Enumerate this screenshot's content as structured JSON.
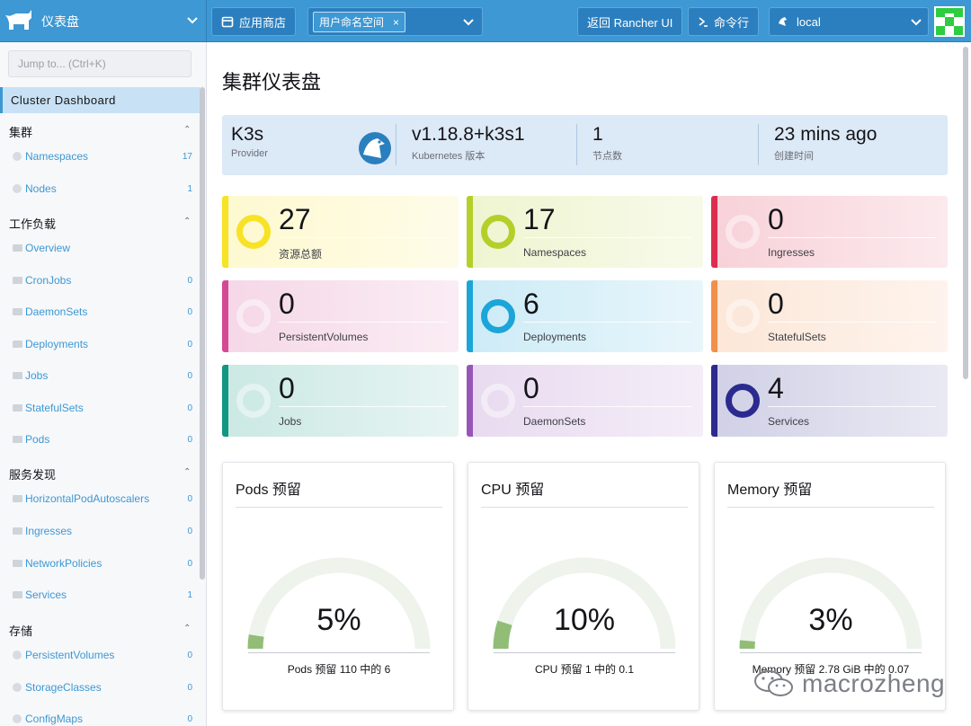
{
  "header": {
    "title": "仪表盘",
    "app_store": "应用商店",
    "namespace_tag": "用户命名空间",
    "namespace_remove": "×",
    "back_rancher": "返回 Rancher UI",
    "kubectl": "命令行",
    "cluster": "local"
  },
  "sidebar": {
    "jump_placeholder": "Jump to... (Ctrl+K)",
    "active": "Cluster Dashboard",
    "groups": [
      {
        "label": "集群"
      },
      {
        "label": "工作负载"
      },
      {
        "label": "服务发现"
      },
      {
        "label": "存储"
      }
    ],
    "items": [
      {
        "label": "Namespaces",
        "count": "17"
      },
      {
        "label": "Nodes",
        "count": "1"
      },
      {
        "label": "Overview",
        "count": ""
      },
      {
        "label": "CronJobs",
        "count": "0"
      },
      {
        "label": "DaemonSets",
        "count": "0"
      },
      {
        "label": "Deployments",
        "count": "0"
      },
      {
        "label": "Jobs",
        "count": "0"
      },
      {
        "label": "StatefulSets",
        "count": "0"
      },
      {
        "label": "Pods",
        "count": "0"
      },
      {
        "label": "HorizontalPodAutoscalers",
        "count": "0"
      },
      {
        "label": "Ingresses",
        "count": "0"
      },
      {
        "label": "NetworkPolicies",
        "count": "0"
      },
      {
        "label": "Services",
        "count": "1"
      },
      {
        "label": "PersistentVolumes",
        "count": "0"
      },
      {
        "label": "StorageClasses",
        "count": "0"
      },
      {
        "label": "ConfigMaps",
        "count": "0"
      }
    ]
  },
  "main": {
    "title": "集群仪表盘",
    "info": {
      "provider_value": "K3s",
      "provider_label": "Provider",
      "version_value": "v1.18.8+k3s1",
      "version_label": "Kubernetes 版本",
      "nodes_value": "1",
      "nodes_label": "节点数",
      "created_value": "23 mins ago",
      "created_label": "创建时间"
    },
    "cards": [
      {
        "value": "27",
        "label": "资源总额",
        "color": "#f7e226"
      },
      {
        "value": "17",
        "label": "Namespaces",
        "color": "#b5cf2a"
      },
      {
        "value": "0",
        "label": "Ingresses",
        "color": "#dd2d4e"
      },
      {
        "value": "0",
        "label": "PersistentVolumes",
        "color": "#d34a92"
      },
      {
        "value": "6",
        "label": "Deployments",
        "color": "#1ba5d8"
      },
      {
        "value": "0",
        "label": "StatefulSets",
        "color": "#f28f4a"
      },
      {
        "value": "0",
        "label": "Jobs",
        "color": "#109883"
      },
      {
        "value": "0",
        "label": "DaemonSets",
        "color": "#9656b9"
      },
      {
        "value": "4",
        "label": "Services",
        "color": "#2b2a8f"
      }
    ],
    "gauges": [
      {
        "title": "Pods 预留",
        "percent": "5%",
        "value": 0.05,
        "sub": "Pods 预留 110 中的 6"
      },
      {
        "title": "CPU 预留",
        "percent": "10%",
        "value": 0.1,
        "sub": "CPU 预留 1 中的 0.1"
      },
      {
        "title": "Memory 预留",
        "percent": "3%",
        "value": 0.03,
        "sub": "Memory 预留 2.78 GiB 中的 0.07"
      }
    ]
  },
  "watermark": "macrozheng",
  "colors": {
    "accent": "#3d98d3",
    "gauge_fill": "#91bd77",
    "gauge_track": "#eef3ec"
  }
}
